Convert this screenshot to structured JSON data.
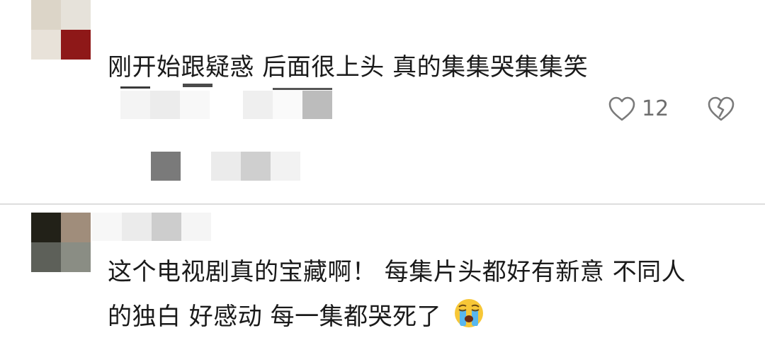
{
  "comments": [
    {
      "text": "刚开始跟疑惑 后面很上头 真的集集哭集集笑",
      "like_count": "12",
      "icons": [
        "heart-outline-icon",
        "broken-heart-icon"
      ]
    },
    {
      "line1": "这个电视剧真的宝藏啊！ 每集片头都好有新意 不同人",
      "line2": "的独白 好感动 每一集都哭死了",
      "emoji": "crying-face-emoji"
    }
  ],
  "colors": {
    "text": "#1a1a1a",
    "icon": "#7a7a7a",
    "divider": "#dedede"
  }
}
